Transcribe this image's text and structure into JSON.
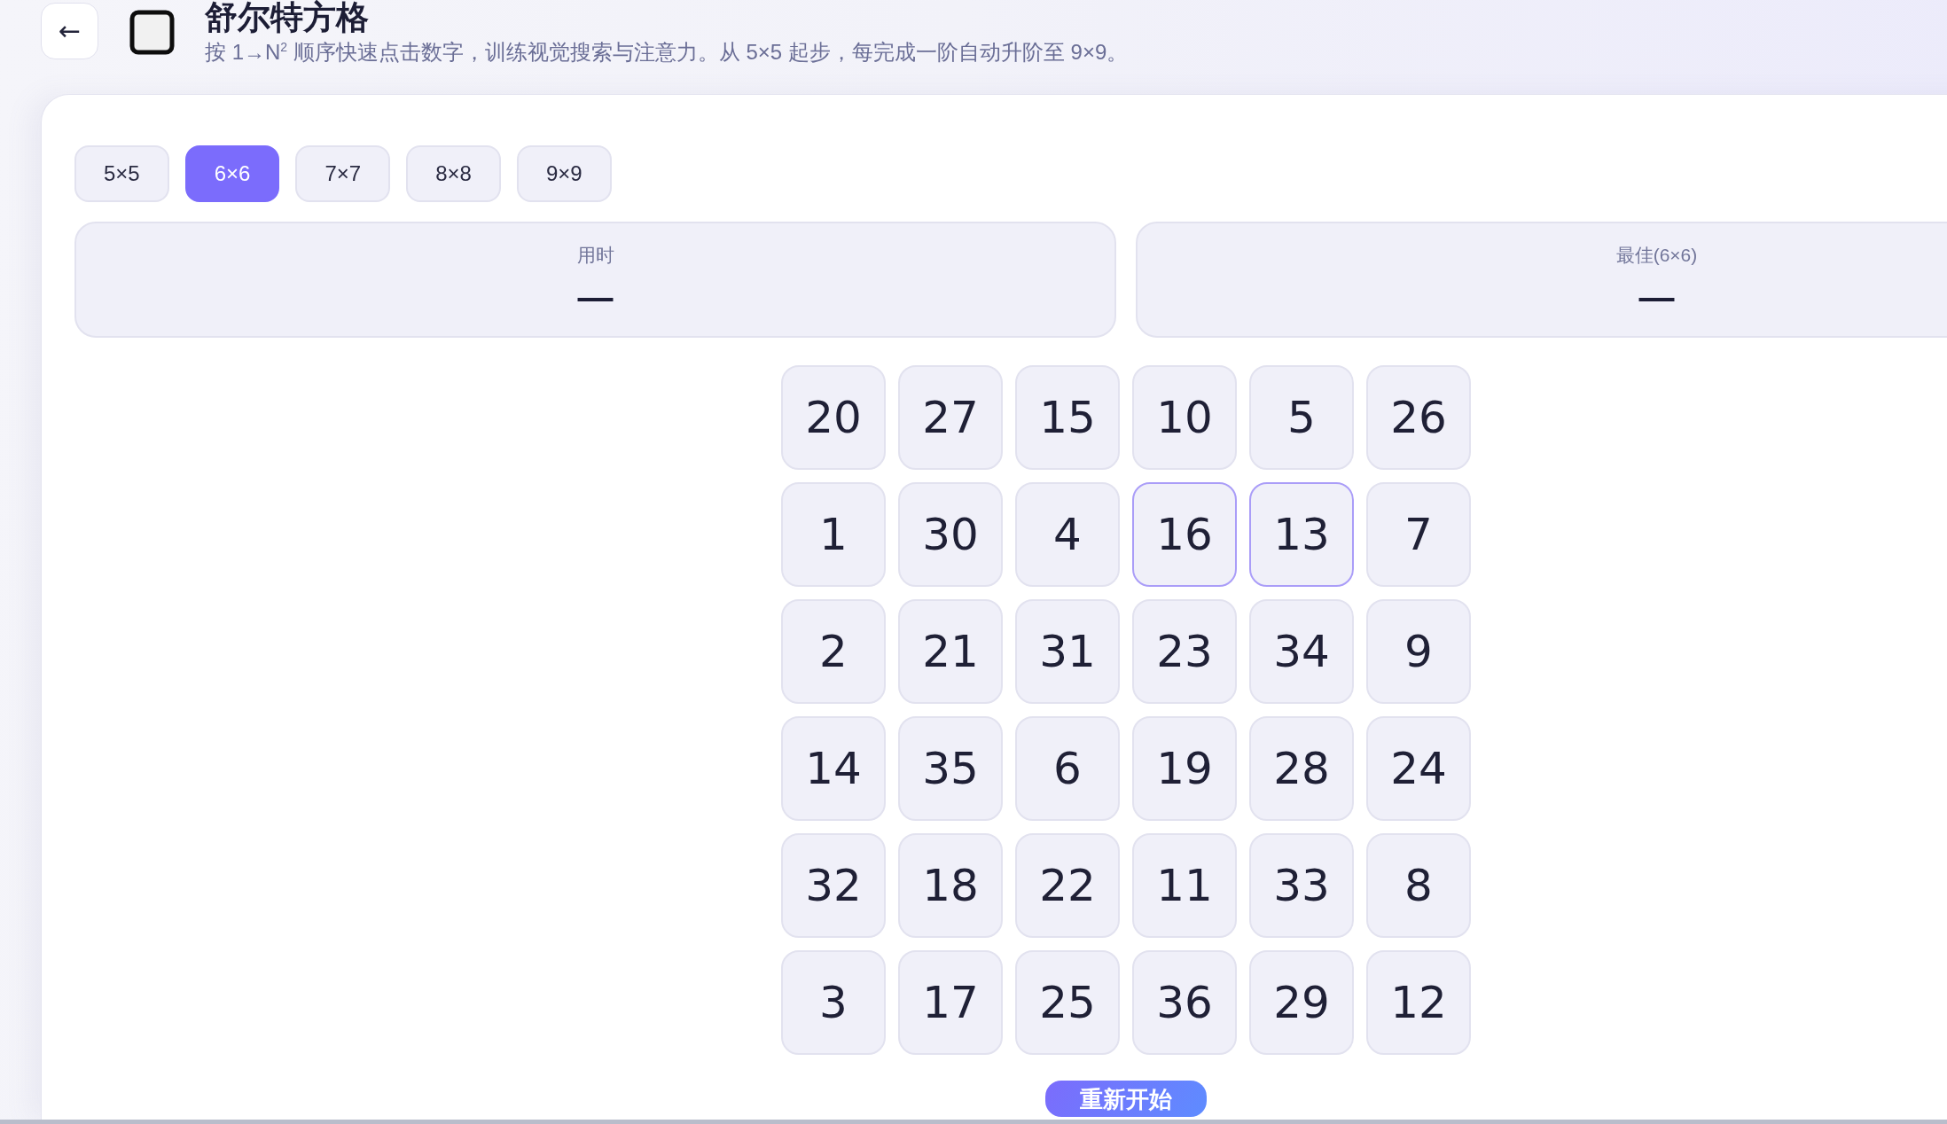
{
  "header": {
    "back_button": "←",
    "title": "舒尔特方格",
    "subtitle": "按 1→N$^{2}$ 顺序快速点击数字，训练视觉搜索与注意力。从 5×5 起步，每完成一阶自动升阶至 9×9。"
  },
  "size_tabs": [
    {
      "label": "5×5",
      "selected": false
    },
    {
      "label": "6×6",
      "selected": true
    },
    {
      "label": "7×7",
      "selected": false
    },
    {
      "label": "8×8",
      "selected": false
    },
    {
      "label": "9×9",
      "selected": false
    }
  ],
  "stats": [
    {
      "label": "用时",
      "value": "—"
    },
    {
      "label": "最佳(6×6)",
      "value": "—"
    }
  ],
  "grid": {
    "rows": [
      [
        {
          "number": "20",
          "highlighted": false
        },
        {
          "number": "27",
          "highlighted": false
        },
        {
          "number": "15",
          "highlighted": false
        },
        {
          "number": "10",
          "highlighted": false
        },
        {
          "number": "5",
          "highlighted": false
        },
        {
          "number": "26",
          "highlighted": false
        }
      ],
      [
        {
          "number": "1",
          "highlighted": false
        },
        {
          "number": "30",
          "highlighted": false
        },
        {
          "number": "4",
          "highlighted": false
        },
        {
          "number": "16",
          "highlighted": true
        },
        {
          "number": "13",
          "highlighted": true
        },
        {
          "number": "7",
          "highlighted": false
        }
      ],
      [
        {
          "number": "2",
          "highlighted": false
        },
        {
          "number": "21",
          "highlighted": false
        },
        {
          "number": "31",
          "highlighted": false
        },
        {
          "number": "23",
          "highlighted": false
        },
        {
          "number": "34",
          "highlighted": false
        },
        {
          "number": "9",
          "highlighted": false
        }
      ],
      [
        {
          "number": "14",
          "highlighted": false
        },
        {
          "number": "35",
          "highlighted": false
        },
        {
          "number": "6",
          "highlighted": false
        },
        {
          "number": "19",
          "highlighted": false
        },
        {
          "number": "28",
          "highlighted": false
        },
        {
          "number": "24",
          "highlighted": false
        }
      ],
      [
        {
          "number": "32",
          "highlighted": false
        },
        {
          "number": "18",
          "highlighted": false
        },
        {
          "number": "22",
          "highlighted": false
        },
        {
          "number": "11",
          "highlighted": false
        },
        {
          "number": "33",
          "highlighted": false
        },
        {
          "number": "8",
          "highlighted": false
        }
      ],
      [
        {
          "number": "3",
          "highlighted": false
        },
        {
          "number": "17",
          "highlighted": false
        },
        {
          "number": "25",
          "highlighted": false
        },
        {
          "number": "36",
          "highlighted": false
        },
        {
          "number": "29",
          "highlighted": false
        },
        {
          "number": "12",
          "highlighted": false
        }
      ]
    ]
  },
  "restart_button": "重新开始"
}
